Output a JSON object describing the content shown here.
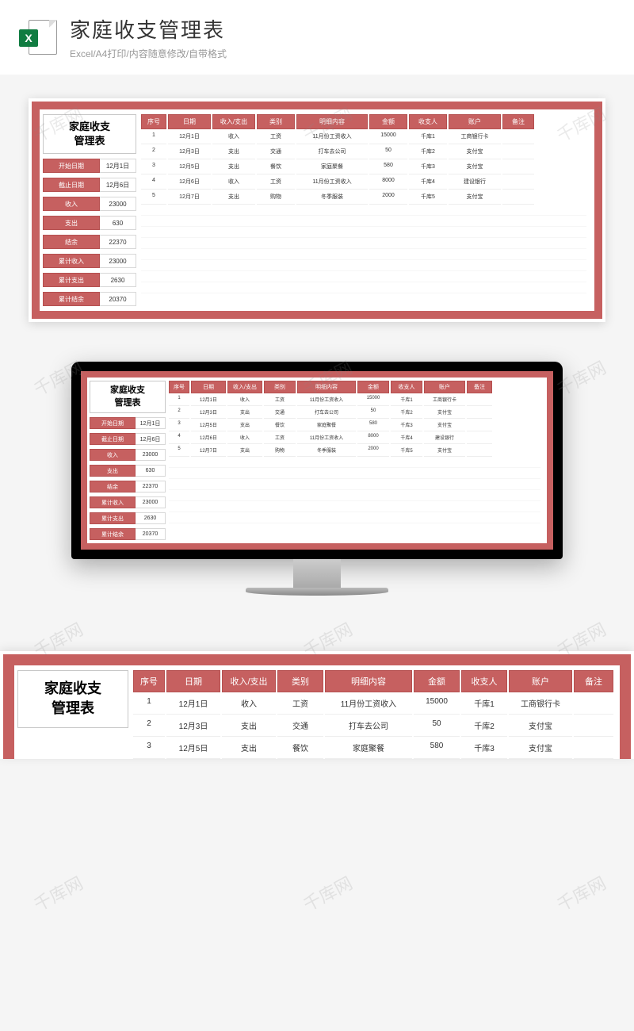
{
  "header": {
    "excel_x": "X",
    "title": "家庭收支管理表",
    "subtitle": "Excel/A4打印/内容随意修改/自带格式"
  },
  "sheet": {
    "title_line1": "家庭收支",
    "title_line2": "管理表",
    "stats": [
      {
        "label": "开始日期",
        "value": "12月1日"
      },
      {
        "label": "截止日期",
        "value": "12月6日"
      },
      {
        "label": "收入",
        "value": "23000"
      },
      {
        "label": "支出",
        "value": "630"
      },
      {
        "label": "结余",
        "value": "22370"
      },
      {
        "label": "累计收入",
        "value": "23000"
      },
      {
        "label": "累计支出",
        "value": "2630"
      },
      {
        "label": "累计结余",
        "value": "20370"
      }
    ],
    "columns": [
      "序号",
      "日期",
      "收入/支出",
      "类别",
      "明细内容",
      "金额",
      "收支人",
      "账户",
      "备注"
    ],
    "rows": [
      {
        "c": [
          "1",
          "12月1日",
          "收入",
          "工资",
          "11月份工资收入",
          "15000",
          "千库1",
          "工商银行卡",
          ""
        ]
      },
      {
        "c": [
          "2",
          "12月3日",
          "支出",
          "交通",
          "打车去公司",
          "50",
          "千库2",
          "支付宝",
          ""
        ]
      },
      {
        "c": [
          "3",
          "12月5日",
          "支出",
          "餐饮",
          "家庭聚餐",
          "580",
          "千库3",
          "支付宝",
          ""
        ]
      },
      {
        "c": [
          "4",
          "12月6日",
          "收入",
          "工资",
          "11月份工资收入",
          "8000",
          "千库4",
          "建设银行",
          ""
        ]
      },
      {
        "c": [
          "5",
          "12月7日",
          "支出",
          "购物",
          "冬季服装",
          "2000",
          "千库5",
          "支付宝",
          ""
        ]
      }
    ]
  },
  "watermark": "千库网"
}
